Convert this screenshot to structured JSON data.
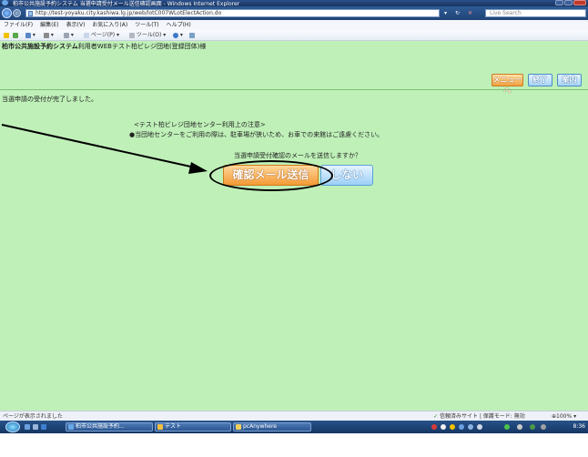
{
  "window": {
    "title": "柏市公共施設予約システム 当選申請受付メール送信確認画面 - Windows Internet Explorer",
    "url": "http://test-yoyaku.city.kashiwa.lg.jp/web/lotC007WLotElectAction.do",
    "search_placeholder": "Live Search"
  },
  "menubar": {
    "file": "ファイル(F)",
    "edit": "編集(E)",
    "view": "表示(V)",
    "favorites": "お気に入り(A)",
    "tools": "ツール(T)",
    "help": "ヘルプ(H)"
  },
  "commandbar": {
    "page": "ページ(P)",
    "tools": "ツール(O)"
  },
  "page": {
    "system_title": "柏市公共施設予約システム",
    "user_greeting": "利用者WEBテスト柏ビレジ団地(登録団体)様",
    "menu_button": "メニューへ",
    "end_button": "終了",
    "guide_button": "案内",
    "message_done": "当選申請の受付が完了しました。",
    "notice_title": "<テスト柏ビレジ団地センター利用上の注意>",
    "notice_body": "●当団地センターをご利用の際は、駐車場が狭いため、お車での来館はご遠慮ください。",
    "question": "当選申請受付確認のメールを送信しますか？",
    "send_button": "確認メール送信",
    "no_button": "しない"
  },
  "statusbar": {
    "left": "ページが表示されました",
    "zone": "信頼済みサイト | 保護モード: 無効",
    "zoom": "100%"
  },
  "taskbar": {
    "task1": "柏市公共施設予約...",
    "task2": "テスト",
    "task3": "pcAnywhere",
    "clock": "8:36"
  }
}
